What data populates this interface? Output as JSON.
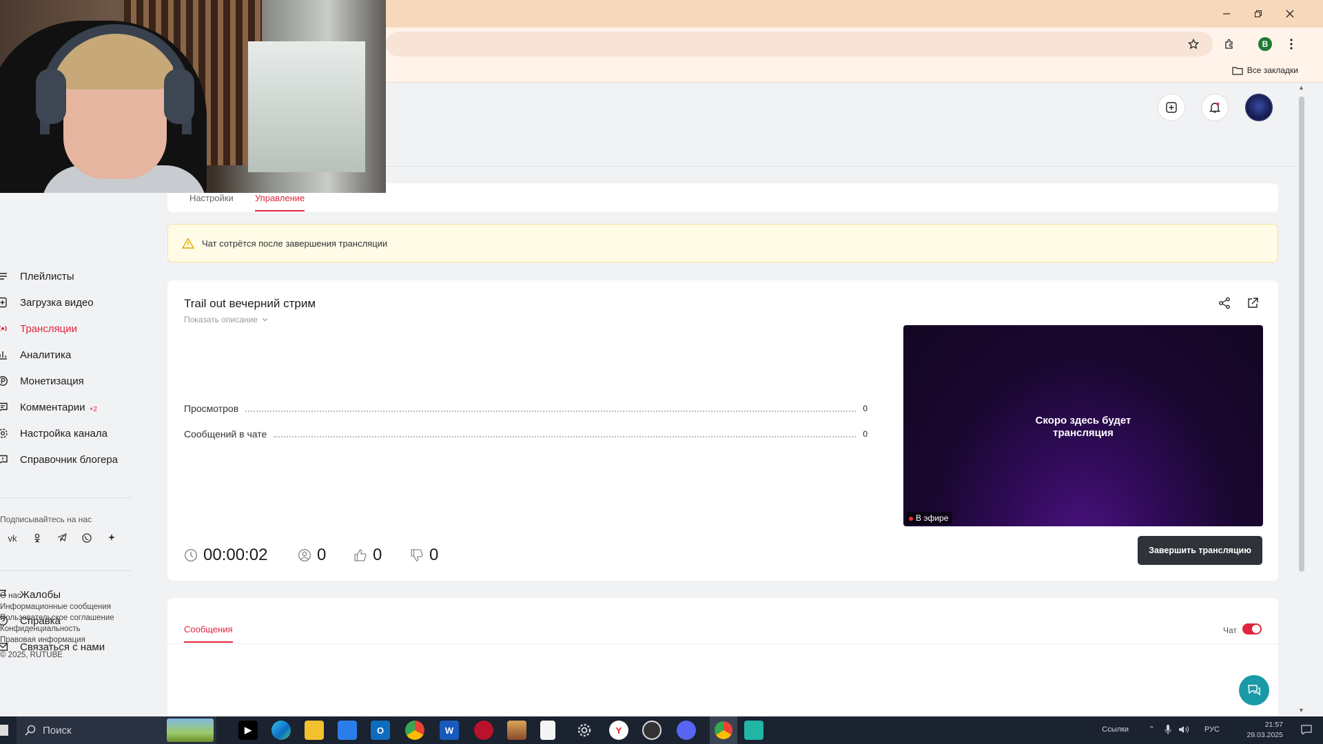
{
  "browser": {
    "bookmarks_all": "Все закладки",
    "profile_letter": "B"
  },
  "sidebar": {
    "items": [
      {
        "label": "Плейлисты",
        "icon": "playlist-icon"
      },
      {
        "label": "Загрузка видео",
        "icon": "upload-icon"
      },
      {
        "label": "Трансляции",
        "icon": "broadcast-icon",
        "active": true
      },
      {
        "label": "Аналитика",
        "icon": "analytics-icon"
      },
      {
        "label": "Монетизация",
        "icon": "monetization-icon"
      },
      {
        "label": "Комментарии",
        "icon": "comments-icon",
        "badge": "+2"
      },
      {
        "label": "Настройка канала",
        "icon": "channel-settings-icon"
      },
      {
        "label": "Справочник блогера",
        "icon": "blogger-guide-icon"
      }
    ],
    "follow_label": "Подписывайтесь на нас",
    "socials": [
      "vk-icon",
      "ok-icon",
      "telegram-icon",
      "viber-icon",
      "more-icon"
    ],
    "support": [
      {
        "label": "Жалобы",
        "icon": "flag-icon"
      },
      {
        "label": "Справка",
        "icon": "help-icon"
      },
      {
        "label": "Связаться с нами",
        "icon": "mail-icon"
      }
    ],
    "footer_links": [
      "О нас",
      "Информационные сообщения",
      "Пользовательское соглашение",
      "Конфиденциальность",
      "Правовая информация"
    ],
    "copyright": "© 2025, RUTUBE"
  },
  "tabs": {
    "settings": "Настройки",
    "management": "Управление",
    "active": "management"
  },
  "warning": {
    "text": "Чат сотрётся после завершения трансляции"
  },
  "stream": {
    "title": "Trail out вечерний стрим",
    "show_description": "Показать описание",
    "stats": [
      {
        "label": "Просмотров",
        "value": "0"
      },
      {
        "label": "Сообщений в чате",
        "value": "0"
      }
    ],
    "preview_text_line1": "Скоро здесь будет",
    "preview_text_line2": "трансляция",
    "live_badge": "В эфире",
    "end_button": "Завершить трансляцию",
    "timer": "00:00:02",
    "viewers": "0",
    "likes": "0",
    "dislikes": "0"
  },
  "messages": {
    "tab": "Сообщения",
    "chat_label": "Чат",
    "chat_enabled": true
  },
  "taskbar": {
    "search_placeholder": "Поиск",
    "links_label": "Ссылки",
    "lang": "РУС",
    "time": "21:57",
    "date": "29.03.2025"
  },
  "colors": {
    "accent": "#e0253d",
    "titlebar": "#f8d8bb",
    "button_dark": "#2f3238",
    "help_fab": "#1a9aa6"
  }
}
